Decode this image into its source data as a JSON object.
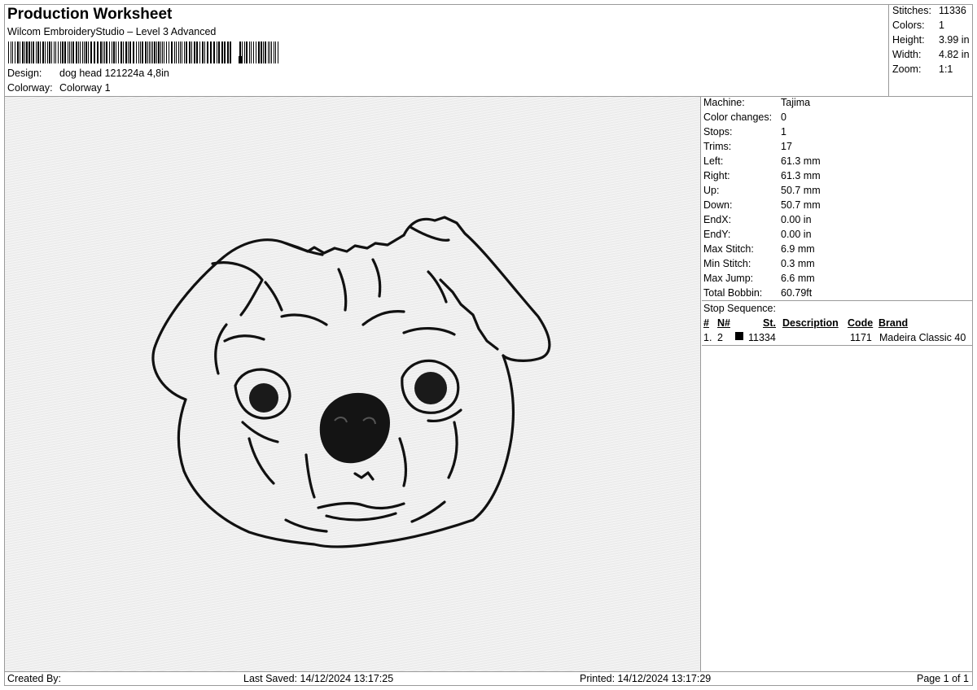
{
  "header": {
    "title": "Production Worksheet",
    "subtitle": "Wilcom EmbroideryStudio – Level 3 Advanced",
    "design_label": "Design:",
    "design_value": "dog head 121224a 4,8in",
    "colorway_label": "Colorway:",
    "colorway_value": "Colorway 1"
  },
  "stats": {
    "stitches_label": "Stitches:",
    "stitches_value": "11336",
    "colors_label": "Colors:",
    "colors_value": "1",
    "height_label": "Height:",
    "height_value": "3.99 in",
    "width_label": "Width:",
    "width_value": "4.82 in",
    "zoom_label": "Zoom:",
    "zoom_value": "1:1"
  },
  "machine_info": [
    {
      "label": "Machine:",
      "value": "Tajima"
    },
    {
      "label": "Color changes:",
      "value": "0"
    },
    {
      "label": "Stops:",
      "value": "1"
    },
    {
      "label": "Trims:",
      "value": "17"
    },
    {
      "label": "Left:",
      "value": "61.3 mm"
    },
    {
      "label": "Right:",
      "value": "61.3 mm"
    },
    {
      "label": "Up:",
      "value": "50.7 mm"
    },
    {
      "label": "Down:",
      "value": "50.7 mm"
    },
    {
      "label": "EndX:",
      "value": "0.00 in"
    },
    {
      "label": "EndY:",
      "value": "0.00 in"
    },
    {
      "label": "Max Stitch:",
      "value": "6.9 mm"
    },
    {
      "label": "Min Stitch:",
      "value": "0.3 mm"
    },
    {
      "label": "Max Jump:",
      "value": "6.6 mm"
    },
    {
      "label": "Total Bobbin:",
      "value": "60.79ft"
    }
  ],
  "stop_sequence": {
    "title": "Stop Sequence:",
    "headers": {
      "num": "#",
      "n": "N#",
      "st": "St.",
      "description": "Description",
      "code": "Code",
      "brand": "Brand"
    },
    "rows": [
      {
        "num": "1.",
        "n": "2",
        "color": "#000000",
        "st": "11334",
        "description": "",
        "code": "1171",
        "brand": "Madeira Classic 40"
      }
    ]
  },
  "footer": {
    "created_by": "Created By:",
    "last_saved": "Last Saved: 14/12/2024 13:17:25",
    "printed": "Printed: 14/12/2024 13:17:29",
    "page": "Page 1 of 1"
  },
  "design_preview": {
    "subject": "pug-dog-head-outline",
    "thread_color": "#000000"
  }
}
